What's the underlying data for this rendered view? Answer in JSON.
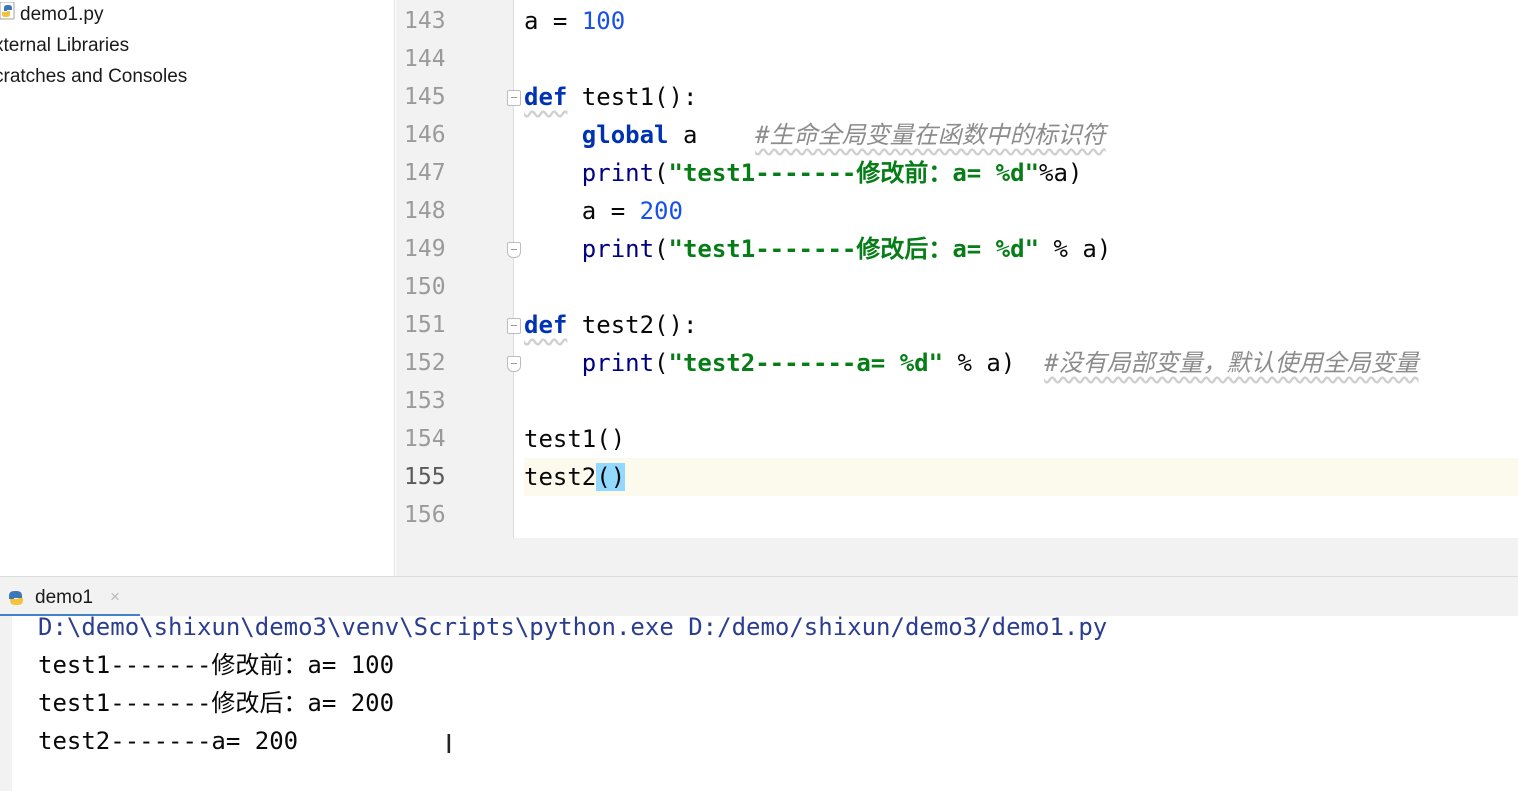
{
  "project_tree": {
    "items": [
      {
        "label": "demo1.py",
        "icon": "python-file-icon"
      },
      {
        "label": "xternal Libraries"
      },
      {
        "label": "cratches and Consoles"
      }
    ]
  },
  "editor": {
    "line_numbers": [
      "143",
      "144",
      "145",
      "146",
      "147",
      "148",
      "149",
      "150",
      "151",
      "152",
      "153",
      "154",
      "155",
      "156"
    ],
    "current_line": "155",
    "lines": {
      "l143": {
        "var": "a",
        "op": " = ",
        "num": "100"
      },
      "l145": {
        "kw": "def",
        "rest": " test1():"
      },
      "l146": {
        "indent": "    ",
        "kw": "global",
        "rest": " a    ",
        "comment": "#生命全局变量在函数中的标识符"
      },
      "l147": {
        "indent": "    ",
        "fn": "print",
        "open": "(",
        "str": "\"test1-------修改前：a= %d\"",
        "rest": "%a)"
      },
      "l148": {
        "indent": "    ",
        "var": "a",
        "op": " = ",
        "num": "200"
      },
      "l149": {
        "indent": "    ",
        "fn": "print",
        "open": "(",
        "str": "\"test1-------修改后：a= %d\"",
        "rest": " % a)"
      },
      "l151": {
        "kw": "def",
        "rest": " test2():"
      },
      "l152": {
        "indent": "    ",
        "fn": "print",
        "open": "(",
        "str": "\"test2-------a= %d\"",
        "rest": " % a)  ",
        "comment": "#没有局部变量，默认使用全局变量"
      },
      "l154": {
        "text": "test1()"
      },
      "l155": {
        "text": "test2",
        "brace": "()"
      }
    }
  },
  "run_panel": {
    "tab_label": "demo1",
    "tab_close": "×",
    "output": {
      "cmd": "D:\\demo\\shixun\\demo3\\venv\\Scripts\\python.exe D:/demo/shixun/demo3/demo1.py",
      "line1": "test1-------修改前：a= 100",
      "line2": "test1-------修改后：a= 200",
      "line3": "test2-------a= 200"
    }
  },
  "cursor_glyph": "I",
  "colors": {
    "keyword": "#0033b3",
    "number": "#1750eb",
    "string": "#067d17",
    "comment": "#8c8c8c",
    "current_line": "#fcfaed",
    "brace_match": "#93d9ff",
    "tab_accent": "#4083c9"
  }
}
